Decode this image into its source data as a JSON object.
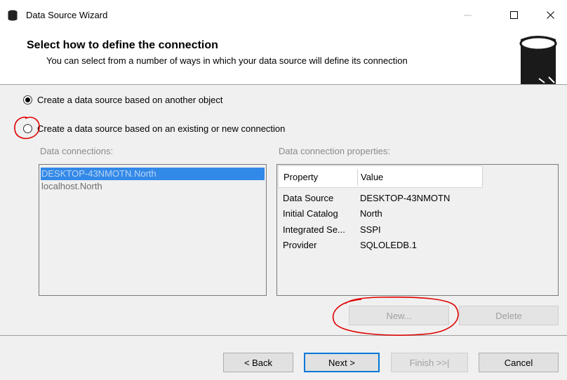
{
  "window": {
    "title": "Data Source Wizard",
    "icons": [
      "database-icon",
      "minimize-icon",
      "maximize-icon",
      "close-icon"
    ]
  },
  "header": {
    "title": "Select how to define the connection",
    "subtitle": "You can select from a number of ways in which your data source will define its connection",
    "icon": "database-icon"
  },
  "options": [
    {
      "label": "Create a data source based on another object",
      "selected": true
    },
    {
      "label": "Create a data source based on an existing or new connection",
      "selected": false
    }
  ],
  "connections": {
    "label": "Data connections:",
    "items": [
      "DESKTOP-43NMOTN.North",
      "localhost.North"
    ],
    "selected_index": 0
  },
  "properties": {
    "label": "Data connection properties:",
    "headers": [
      "Property",
      "Value"
    ],
    "rows": [
      [
        "Data Source",
        "DESKTOP-43NMOTN"
      ],
      [
        "Initial Catalog",
        "North"
      ],
      [
        "Integrated Se...",
        "SSPI"
      ],
      [
        "Provider",
        "SQLOLEDB.1"
      ]
    ]
  },
  "buttons": {
    "new": "New...",
    "delete": "Delete",
    "back": "< Back",
    "next": "Next >",
    "finish": "Finish >>|",
    "cancel": "Cancel"
  },
  "colors": {
    "annotation": "#e00000",
    "selection": "#3389e8",
    "accent": "#0078d7"
  }
}
